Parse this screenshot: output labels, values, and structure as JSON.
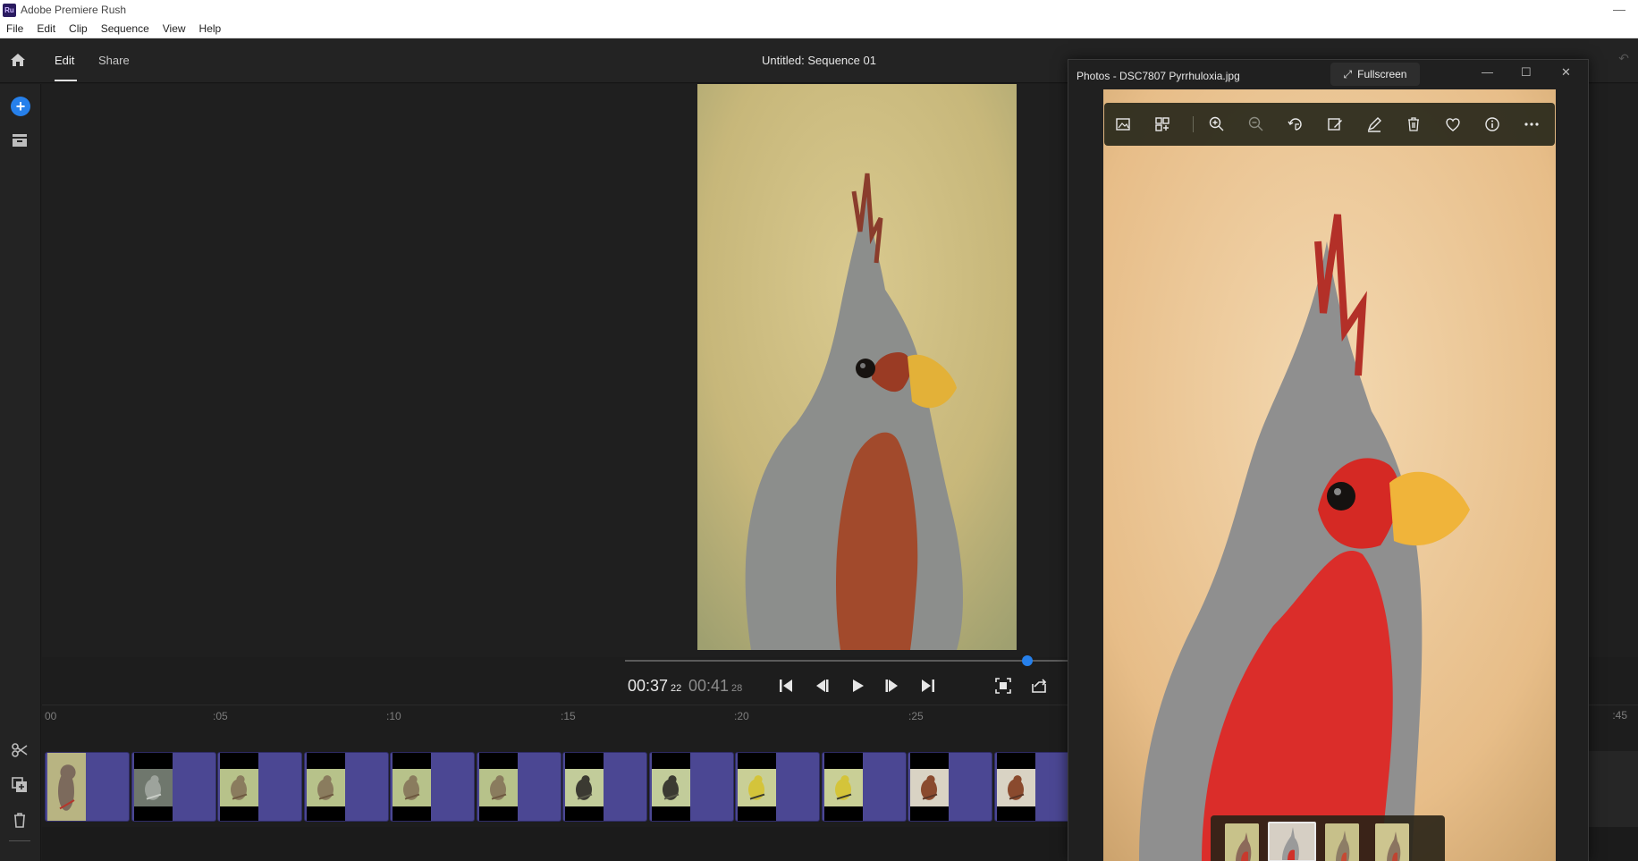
{
  "window": {
    "title": "Adobe Premiere Rush",
    "logo_text": "Ru"
  },
  "menu": [
    "File",
    "Edit",
    "Clip",
    "Sequence",
    "View",
    "Help"
  ],
  "header": {
    "tabs": [
      {
        "label": "Edit",
        "active": true
      },
      {
        "label": "Share",
        "active": false
      }
    ],
    "sequence_title": "Untitled: Sequence 01"
  },
  "player": {
    "current_time": "00:37",
    "current_frames": "22",
    "duration_time": "00:41",
    "duration_frames": "28",
    "progress": 0.91
  },
  "timeline": {
    "ruler_ticks": [
      "00",
      ":05",
      ":10",
      ":15",
      ":20",
      ":25"
    ],
    "ruler_tick_right": ":45",
    "clips": [
      {
        "bird": "cardinal"
      },
      {
        "bird": "gray"
      },
      {
        "bird": "sparrow"
      },
      {
        "bird": "sparrow"
      },
      {
        "bird": "sparrow"
      },
      {
        "bird": "sparrow"
      },
      {
        "bird": "dark"
      },
      {
        "bird": "dark"
      },
      {
        "bird": "yellow"
      },
      {
        "bird": "yellow"
      },
      {
        "bird": "brown"
      },
      {
        "bird": "brown"
      }
    ]
  },
  "photos": {
    "title": "Photos - DSC7807 Pyrrhuloxia.jpg",
    "fullscreen_label": "Fullscreen",
    "toolbar_icons": [
      "gallery-icon",
      "compare-icon",
      "zoom-in-icon",
      "zoom-out-icon",
      "rotate-icon",
      "edit-image-icon",
      "draw-icon",
      "delete-icon",
      "favorite-icon",
      "info-icon",
      "more-icon"
    ]
  },
  "colors": {
    "accent": "#2680eb",
    "clip": "#4b4793",
    "app_bg": "#1d1d1d"
  }
}
